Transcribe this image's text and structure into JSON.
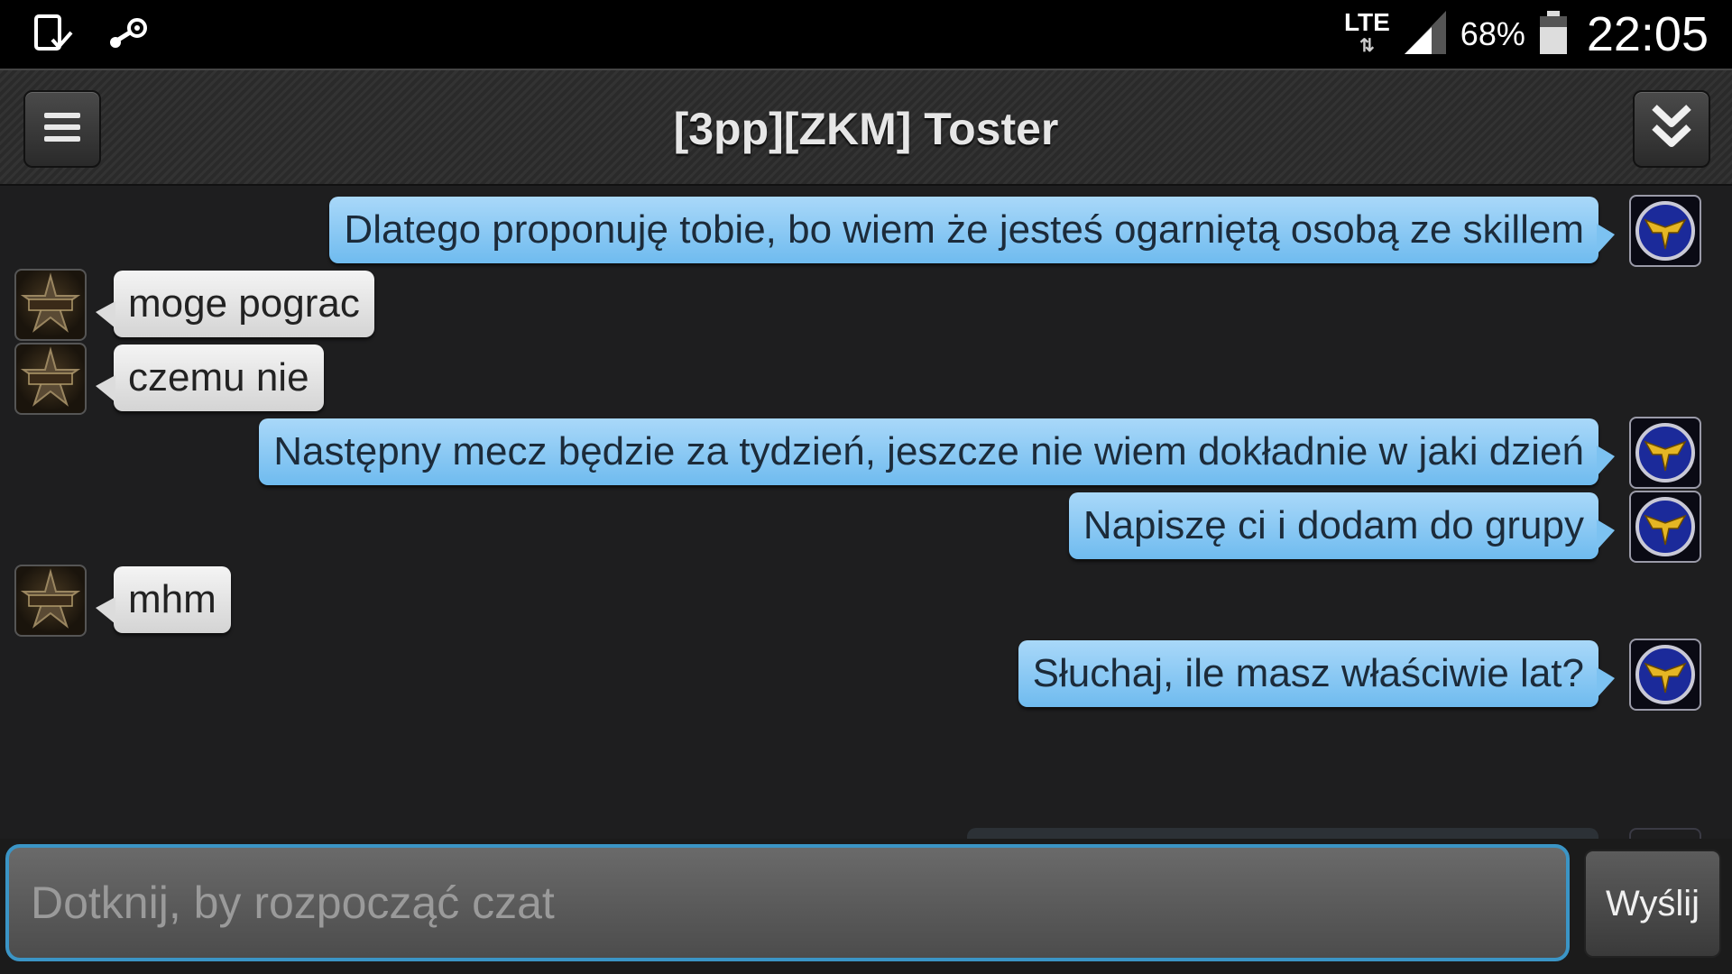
{
  "status_bar": {
    "left_icons": [
      "screenshot-saved-icon",
      "steam-icon"
    ],
    "network_type": "LTE",
    "data_arrows": "⇅",
    "battery_percent": "68%",
    "time": "22:05"
  },
  "header": {
    "title": "[3pp][ZKM] Toster",
    "menu_icon": "hamburger-menu-icon",
    "scroll_icon": "double-chevron-down-icon"
  },
  "messages": [
    {
      "sender": "me",
      "text": "Dlatego proponuję tobie, bo wiem że jesteś ogarniętą osobą ze skillem"
    },
    {
      "sender": "them",
      "text": "moge pograc"
    },
    {
      "sender": "them",
      "text": "czemu nie"
    },
    {
      "sender": "me",
      "text": "Następny mecz będzie za tydzień, jeszcze nie wiem dokładnie w jaki dzień"
    },
    {
      "sender": "me",
      "text": "Napiszę ci i dodam do grupy"
    },
    {
      "sender": "them",
      "text": "mhm"
    },
    {
      "sender": "me",
      "text": "Słuchaj, ile masz właściwie lat?"
    }
  ],
  "composer": {
    "placeholder": "Dotknij, by rozpocząć czat",
    "send_label": "Wyślij"
  },
  "colors": {
    "my_bubble": "#8cc9f4",
    "their_bubble": "#e6e6e6",
    "input_border": "#3b95c6",
    "background": "#1e1e1f"
  }
}
